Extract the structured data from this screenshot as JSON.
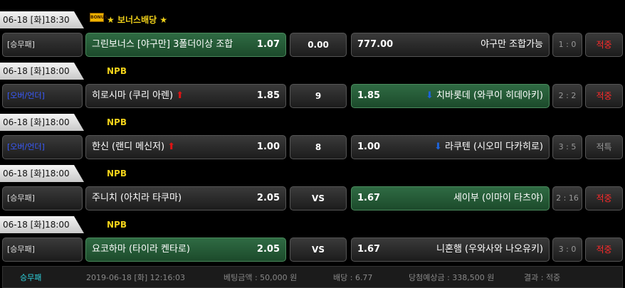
{
  "sections": [
    {
      "header": {
        "datetime": "06-18 [화]18:30",
        "league": "보너스배당",
        "bonus_badge": "BONUS"
      },
      "bet_type": "[승무패]",
      "home": {
        "name": "그린보너스 [야구만] 3폴더이상 조합",
        "odds": "1.07"
      },
      "mid": "0.00",
      "away": {
        "odds": "777.00",
        "name": "야구만 조합가능"
      },
      "score": "1 : 0",
      "result": "적중"
    },
    {
      "header": {
        "datetime": "06-18 [화]18:00",
        "league": "NPB"
      },
      "bet_type": "[오버/언더]",
      "home": {
        "name": "히로시마 (쿠리 아렌)",
        "odds": "1.85"
      },
      "mid": "9",
      "away": {
        "odds": "1.85",
        "name": "치바롯데 (와쿠이 히데아키)"
      },
      "score": "2 : 2",
      "result": "적중"
    },
    {
      "header": {
        "datetime": "06-18 [화]18:00",
        "league": "NPB"
      },
      "bet_type": "[오버/언더]",
      "home": {
        "name": "한신 (랜디 메신저)",
        "odds": "1.00"
      },
      "mid": "8",
      "away": {
        "odds": "1.00",
        "name": "라쿠텐 (시오미 다카히로)"
      },
      "score": "3 : 5",
      "result": "적특"
    },
    {
      "header": {
        "datetime": "06-18 [화]18:00",
        "league": "NPB"
      },
      "bet_type": "[승무패]",
      "home": {
        "name": "주니치 (아치라 타쿠마)",
        "odds": "2.05"
      },
      "mid": "VS",
      "away": {
        "odds": "1.67",
        "name": "세이부 (이마이 타츠야)"
      },
      "score": "2 : 16",
      "result": "적중"
    },
    {
      "header": {
        "datetime": "06-18 [화]18:00",
        "league": "NPB"
      },
      "bet_type": "[승무패]",
      "home": {
        "name": "요코하마 (타이라 켄타로)",
        "odds": "2.05"
      },
      "mid": "VS",
      "away": {
        "odds": "1.67",
        "name": "니혼햄 (우와사와 나오유키)"
      },
      "score": "3 : 0",
      "result": "적중"
    }
  ],
  "footer": {
    "type": "승무패",
    "datetime": "2019-06-18 [화] 12:16:03",
    "bet_amount": "베팅금액 : 50,000 원",
    "odds": "배당 : 6.77",
    "expected": "당첨예상금 : 338,500 원",
    "result": "결과 : 적중"
  },
  "colors": {
    "highlight_green": "#2f6b43",
    "league_yellow": "#f2d21a",
    "hit_red": "#ff2a2a",
    "ou_blue": "#3a5bff",
    "footer_cyan": "#2fd5e0"
  }
}
